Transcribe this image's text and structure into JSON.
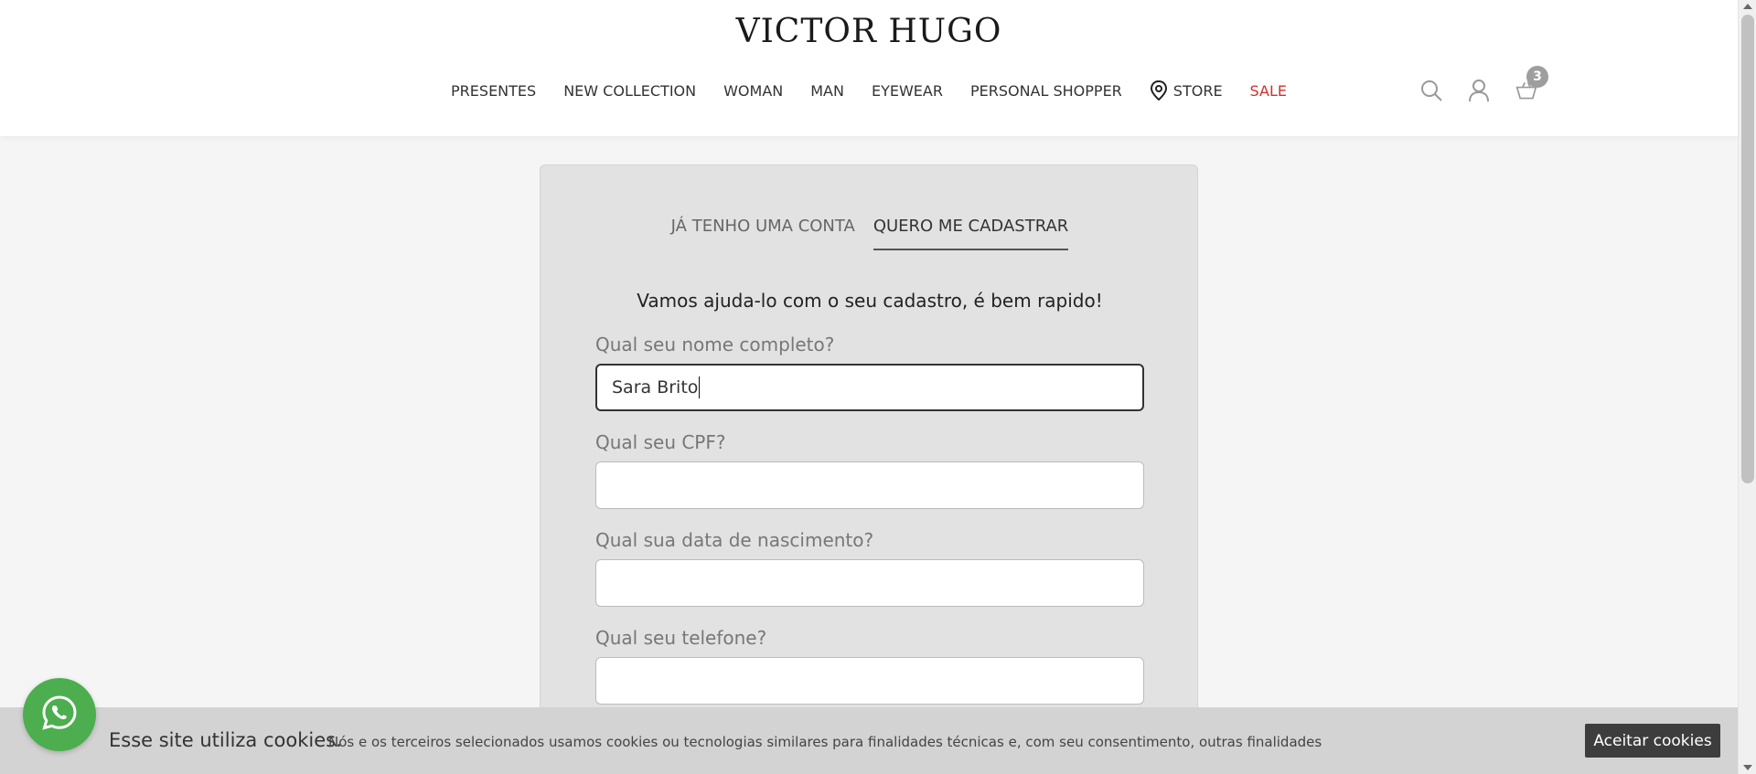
{
  "header": {
    "logo": "VICTOR HUGO",
    "nav": [
      {
        "label": "PRESENTES"
      },
      {
        "label": "NEW COLLECTION"
      },
      {
        "label": "WOMAN"
      },
      {
        "label": "MAN"
      },
      {
        "label": "EYEWEAR"
      },
      {
        "label": "PERSONAL SHOPPER"
      },
      {
        "label": "STORE",
        "icon": "location-pin-icon"
      },
      {
        "label": "SALE",
        "color": "#d32f2f"
      }
    ],
    "cart_count": "3",
    "icons": [
      "search-icon",
      "user-icon",
      "cart-icon"
    ]
  },
  "card": {
    "tabs": [
      {
        "label": "JÁ TENHO UMA CONTA",
        "active": false
      },
      {
        "label": "QUERO ME CADASTRAR",
        "active": true
      }
    ],
    "subtitle": "Vamos ajuda-lo com o seu cadastro, é bem rapido!",
    "fields": [
      {
        "label": "Qual seu nome completo?",
        "value": "Sara Brito",
        "focused": true
      },
      {
        "label": "Qual seu CPF?",
        "value": ""
      },
      {
        "label": "Qual sua data de nascimento?",
        "value": ""
      },
      {
        "label": "Qual seu telefone?",
        "value": ""
      }
    ]
  },
  "cookie": {
    "main": "Esse site utiliza cookies.",
    "detail": "Nós e os terceiros selecionados usamos cookies ou tecnologias similares para finalidades técnicas e, com seu consentimento, outras finalidades",
    "button": "Aceitar cookies"
  },
  "colors": {
    "sale": "#d32f2f",
    "whatsapp": "#4cae4f",
    "card_bg": "#e2e2e2",
    "cookie_button": "#3d3d3d"
  }
}
